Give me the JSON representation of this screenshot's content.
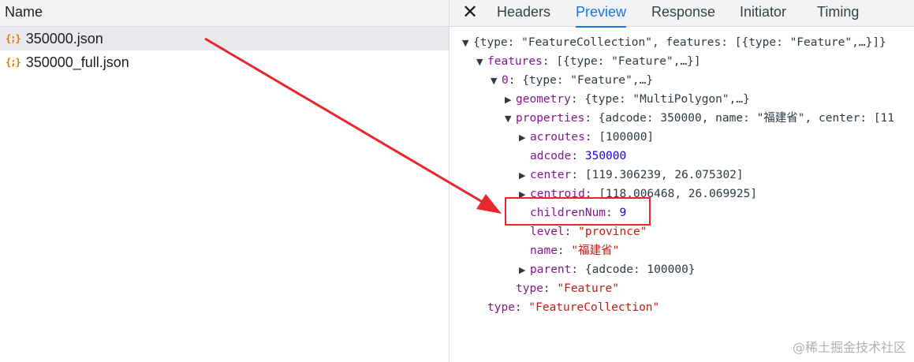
{
  "left": {
    "header": "Name",
    "files": [
      {
        "icon": "{;}",
        "name": "350000.json"
      },
      {
        "icon": "{;}",
        "name": "350000_full.json"
      }
    ]
  },
  "right": {
    "close_icon": "✕",
    "tabs": [
      "Headers",
      "Preview",
      "Response",
      "Initiator",
      "Timing"
    ],
    "active_tab": "Preview",
    "tree": [
      {
        "indent": 0,
        "arrow": "▼",
        "key": "",
        "sep": "",
        "value": "{type: \"FeatureCollection\", features: [{type: \"Feature\",…}]}",
        "vclass": "p"
      },
      {
        "indent": 1,
        "arrow": "▼",
        "key": "features",
        "sep": ": ",
        "value": "[{type: \"Feature\",…}]",
        "vclass": "p"
      },
      {
        "indent": 2,
        "arrow": "▼",
        "key": "0",
        "sep": ": ",
        "value": "{type: \"Feature\",…}",
        "vclass": "p"
      },
      {
        "indent": 3,
        "arrow": "▶",
        "key": "geometry",
        "sep": ": ",
        "value": "{type: \"MultiPolygon\",…}",
        "vclass": "p"
      },
      {
        "indent": 3,
        "arrow": "▼",
        "key": "properties",
        "sep": ": ",
        "value": "{adcode: 350000, name: \"福建省\", center: [11",
        "vclass": "p"
      },
      {
        "indent": 4,
        "arrow": "▶",
        "key": "acroutes",
        "sep": ": ",
        "value": "[100000]",
        "vclass": "p"
      },
      {
        "indent": 4,
        "arrow": "",
        "key": "adcode",
        "sep": ": ",
        "value": "350000",
        "vclass": "n"
      },
      {
        "indent": 4,
        "arrow": "▶",
        "key": "center",
        "sep": ": ",
        "value": "[119.306239, 26.075302]",
        "vclass": "p"
      },
      {
        "indent": 4,
        "arrow": "▶",
        "key": "centroid",
        "sep": ": ",
        "value": "[118.006468, 26.069925]",
        "vclass": "p"
      },
      {
        "indent": 4,
        "arrow": "",
        "key": "childrenNum",
        "sep": ": ",
        "value": "9",
        "vclass": "n"
      },
      {
        "indent": 4,
        "arrow": "",
        "key": "level",
        "sep": ": ",
        "value": "\"province\"",
        "vclass": "s"
      },
      {
        "indent": 4,
        "arrow": "",
        "key": "name",
        "sep": ": ",
        "value": "\"福建省\"",
        "vclass": "s"
      },
      {
        "indent": 4,
        "arrow": "▶",
        "key": "parent",
        "sep": ": ",
        "value": "{adcode: 100000}",
        "vclass": "p"
      },
      {
        "indent": 3,
        "arrow": "",
        "key": "type",
        "sep": ": ",
        "value": "\"Feature\"",
        "vclass": "s"
      },
      {
        "indent": 1,
        "arrow": "",
        "key": "type",
        "sep": ": ",
        "value": "\"FeatureCollection\"",
        "vclass": "s"
      }
    ]
  },
  "annotation": {
    "color": "#e8262b",
    "highlighted": "childrenNum: 9"
  },
  "watermark": "@稀土掘金技术社区"
}
